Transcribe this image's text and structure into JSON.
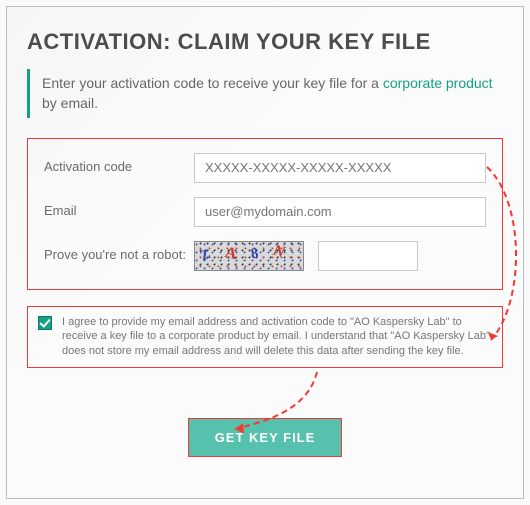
{
  "title": "ACTIVATION: CLAIM YOUR KEY FILE",
  "intro": {
    "pre": "Enter your activation code to receive your key file for a ",
    "link": "corporate product",
    "post": " by email."
  },
  "form": {
    "activation_label": "Activation code",
    "activation_placeholder": "XXXXX-XXXXX-XXXXX-XXXXX",
    "email_label": "Email",
    "email_placeholder": "user@mydomain.com",
    "captcha_label": "Prove you're not a robot:",
    "captcha_chars": {
      "c1": "Z",
      "c2": "A",
      "c3": "8",
      "c4": "N"
    }
  },
  "agree": {
    "checked": true,
    "text": "I agree to provide my email address and activation code to \"AO Kaspersky Lab\" to receive a key file to a corporate product by email. I understand that \"AO Kaspersky Lab\" does not store my email address and will delete this data after sending the key file."
  },
  "button": "GET KEY FILE"
}
